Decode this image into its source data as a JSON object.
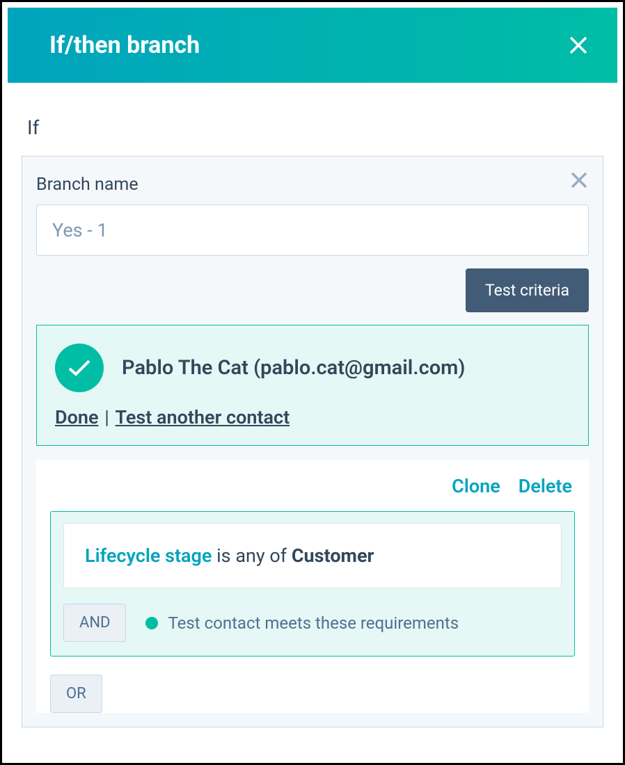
{
  "header": {
    "title": "If/then branch"
  },
  "section": {
    "if_label": "If",
    "branch_name_label": "Branch name",
    "branch_name_value": "Yes - 1",
    "test_criteria_btn": "Test criteria"
  },
  "result": {
    "contact": "Pablo The Cat (pablo.cat@gmail.com)",
    "done_label": "Done",
    "test_another_label": "Test another contact"
  },
  "criteria": {
    "clone_label": "Clone",
    "delete_label": "Delete",
    "property": "Lifecycle stage",
    "operator": " is any of ",
    "value": "Customer",
    "and_label": "AND",
    "or_label": "OR",
    "status_text": "Test contact meets these requirements"
  }
}
